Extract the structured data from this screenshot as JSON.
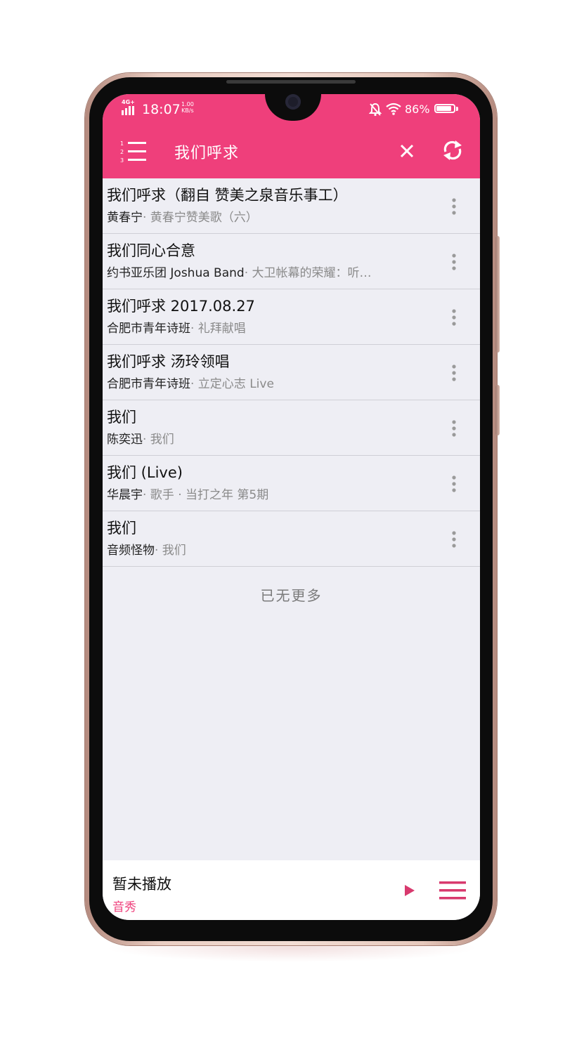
{
  "colors": {
    "accent": "#ef3f7b",
    "list_bg": "#eeeef4",
    "frame": "#e9cdc2"
  },
  "status_bar": {
    "network": "4G+",
    "time": "18:07",
    "speed_value": "1.00",
    "speed_unit": "KB/s",
    "battery_percent": "86%",
    "battery_level": 0.86,
    "icons": [
      "signal-icon",
      "bell-muted-icon",
      "wifi-icon",
      "battery-icon"
    ]
  },
  "toolbar": {
    "menu_icon": "numbered-list-icon",
    "title": "我们呼求",
    "close_icon": "close-icon",
    "refresh_icon": "refresh-icon"
  },
  "results": [
    {
      "title": "我们呼求（翻自 赞美之泉音乐事工）",
      "artist": "黄春宁",
      "album": "· 黄春宁赞美歌（六）"
    },
    {
      "title": "我们同心合意",
      "artist": "约书亚乐团 Joshua Band",
      "album": "· 大卫帐幕的荣耀：听…"
    },
    {
      "title": "我们呼求 2017.08.27",
      "artist": "合肥市青年诗班",
      "album": "· 礼拜献唱"
    },
    {
      "title": "我们呼求 汤玲领唱",
      "artist": "合肥市青年诗班",
      "album": "· 立定心志 Live"
    },
    {
      "title": "我们",
      "artist": "陈奕迅",
      "album": "· 我们"
    },
    {
      "title": "我们 (Live)",
      "artist": "华晨宇",
      "album": "· 歌手 · 当打之年 第5期"
    },
    {
      "title": "我们",
      "artist": "音频怪物",
      "album": "· 我们"
    }
  ],
  "list_end_text": "已无更多",
  "player": {
    "title": "暂未播放",
    "subtitle": "音秀",
    "play_icon": "play-icon",
    "queue_icon": "playlist-icon"
  }
}
